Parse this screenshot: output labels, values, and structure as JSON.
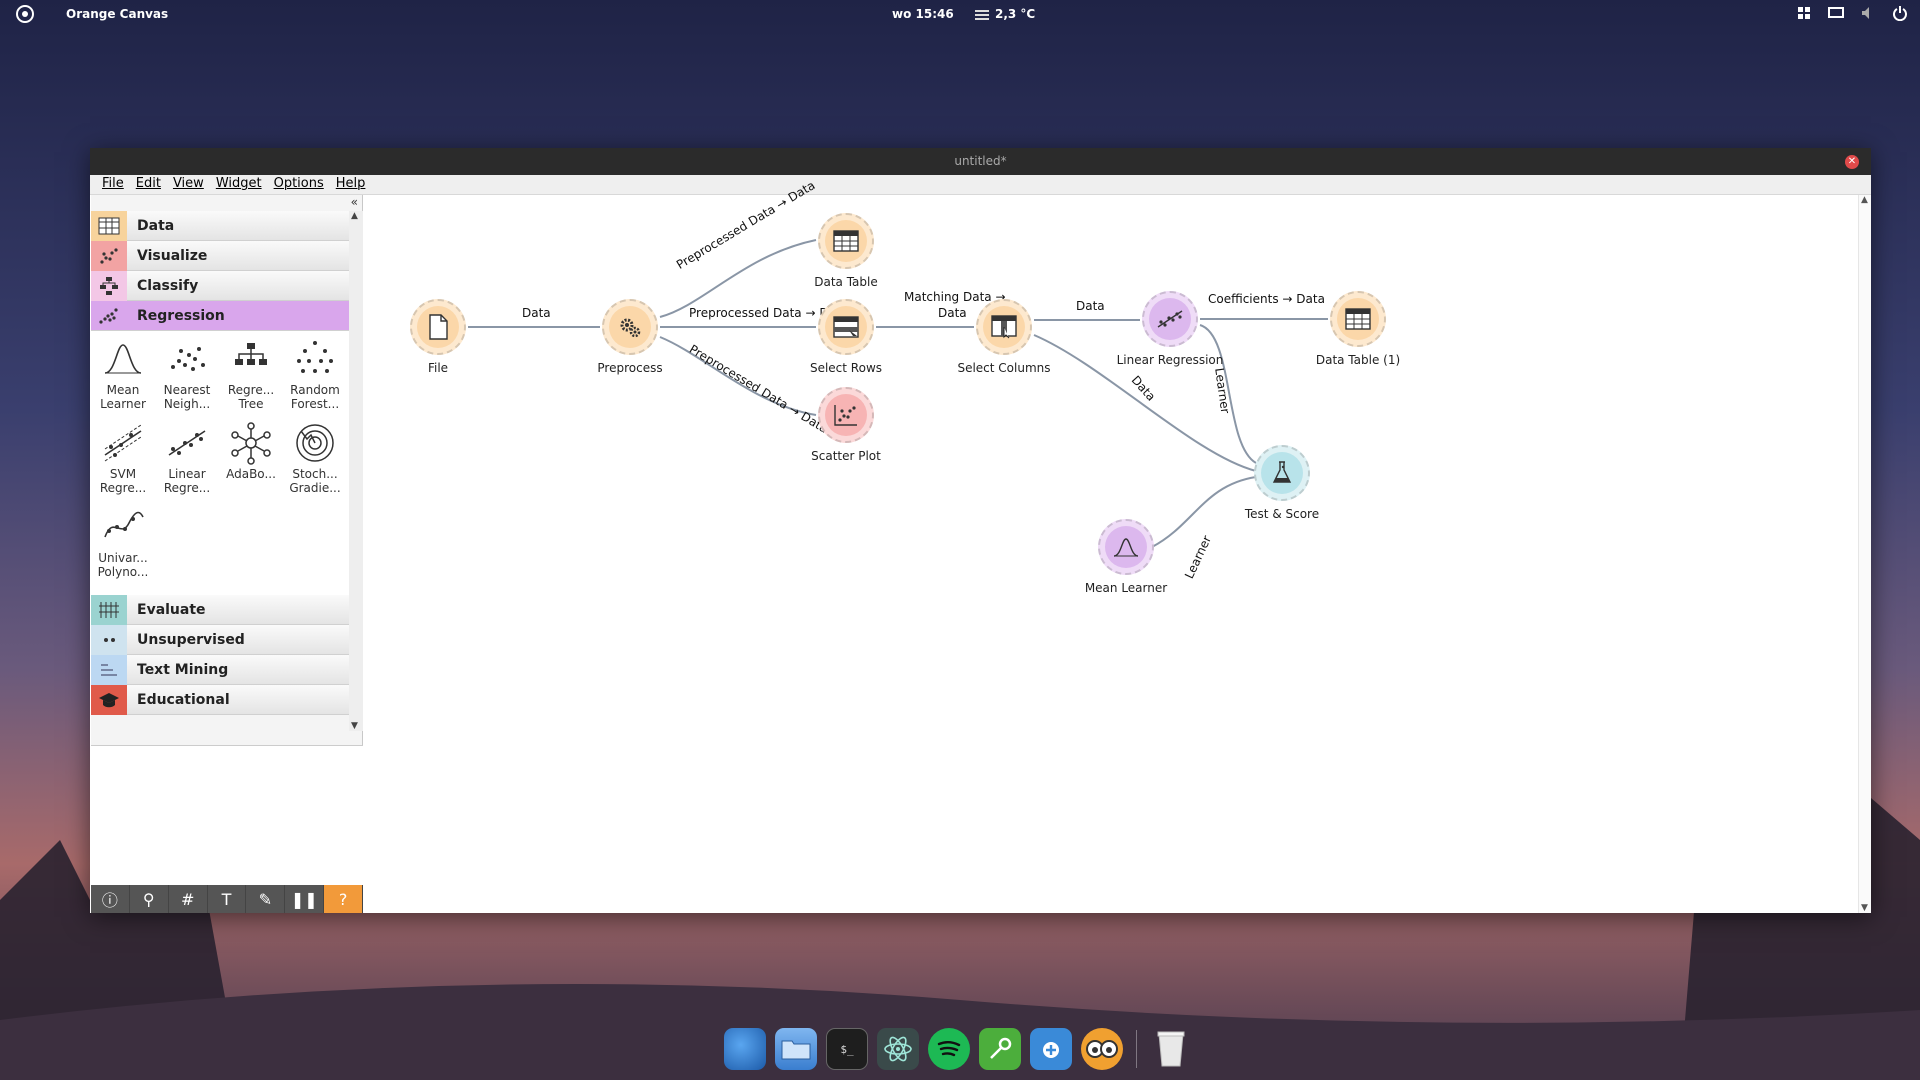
{
  "topbar": {
    "app_name": "Orange Canvas",
    "clock": "wo 15:46",
    "weather": "2,3 °C"
  },
  "window": {
    "title": "untitled*",
    "menu": [
      "File",
      "Edit",
      "View",
      "Widget",
      "Options",
      "Help"
    ]
  },
  "dock": {
    "categories": [
      {
        "label": "Data",
        "color": "#f7d39c"
      },
      {
        "label": "Visualize",
        "color": "#f2a3a3"
      },
      {
        "label": "Classify",
        "color": "#f3c7e6"
      },
      {
        "label": "Regression",
        "color": "#d9a6ec",
        "active": true
      }
    ],
    "widgets": [
      {
        "line1": "Mean",
        "line2": "Learner",
        "icon": "bell-curve-icon"
      },
      {
        "line1": "Nearest",
        "line2": "Neigh...",
        "icon": "nearest-neighbors-icon"
      },
      {
        "line1": "Regre...",
        "line2": "Tree",
        "icon": "tree-icon"
      },
      {
        "line1": "Random",
        "line2": "Forest...",
        "icon": "forest-icon"
      },
      {
        "line1": "SVM",
        "line2": "Regre...",
        "icon": "svm-icon"
      },
      {
        "line1": "Linear",
        "line2": "Regre...",
        "icon": "linear-regression-icon"
      },
      {
        "line1": "AdaBo...",
        "line2": "",
        "icon": "adaboost-icon"
      },
      {
        "line1": "Stoch...",
        "line2": "Gradie...",
        "icon": "sgd-icon"
      },
      {
        "line1": "Univar...",
        "line2": "Polyno...",
        "icon": "polynomial-icon"
      }
    ],
    "more_categories": [
      {
        "label": "Evaluate",
        "color": "#9ad3d0"
      },
      {
        "label": "Unsupervised",
        "color": "#cfe3ef"
      },
      {
        "label": "Text Mining",
        "color": "#bcd8f2"
      },
      {
        "label": "Educational",
        "color": "#e05a4a"
      }
    ]
  },
  "canvas": {
    "nodes": {
      "file": "File",
      "preprocess": "Preprocess",
      "data_table": "Data Table",
      "select_rows": "Select Rows",
      "scatter_plot": "Scatter Plot",
      "select_columns": "Select Columns",
      "linear_regression": "Linear Regression",
      "data_table_1": "Data Table (1)",
      "test_score": "Test & Score",
      "mean_learner": "Mean Learner"
    },
    "links": {
      "file_preprocess": "Data",
      "pre_table": "Preprocessed Data → Data",
      "pre_rows": "Preprocessed Data → Data",
      "pre_scatter": "Preprocessed Data → Data",
      "rows_cols_1": "Matching Data →",
      "rows_cols_2": "Data",
      "cols_lr": "Data",
      "lr_table": "Coefficients → Data",
      "lr_test": "Learner",
      "cols_test": "Data",
      "mean_test": "Learner"
    }
  }
}
